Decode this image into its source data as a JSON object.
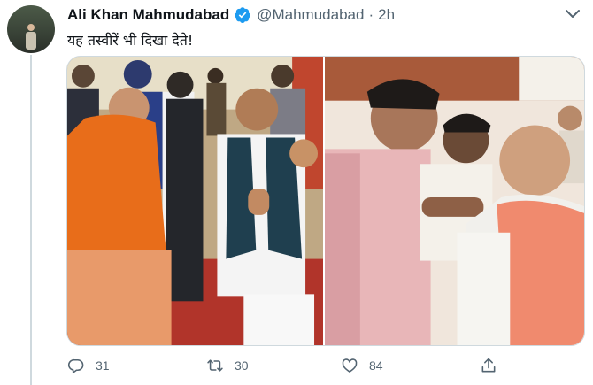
{
  "author": {
    "name": "Ali Khan Mahmudabad",
    "handle": "@Mahmudabad",
    "separator": "·",
    "time": "2h",
    "verified": true
  },
  "tweet": {
    "text": "यह तस्वीरें भी दिखा देते!"
  },
  "media": {
    "photos": [
      {
        "name": "photo-left"
      },
      {
        "name": "photo-right"
      }
    ]
  },
  "actions": {
    "reply_count": "31",
    "retweet_count": "30",
    "like_count": "84"
  },
  "icons": [
    "reply-icon",
    "retweet-icon",
    "like-icon",
    "share-icon",
    "verified-badge-icon",
    "more-caret-icon"
  ],
  "colors": {
    "text": "#0f1419",
    "secondary": "#536471",
    "verified": "#1d9bf0",
    "border": "#cfd9de"
  }
}
